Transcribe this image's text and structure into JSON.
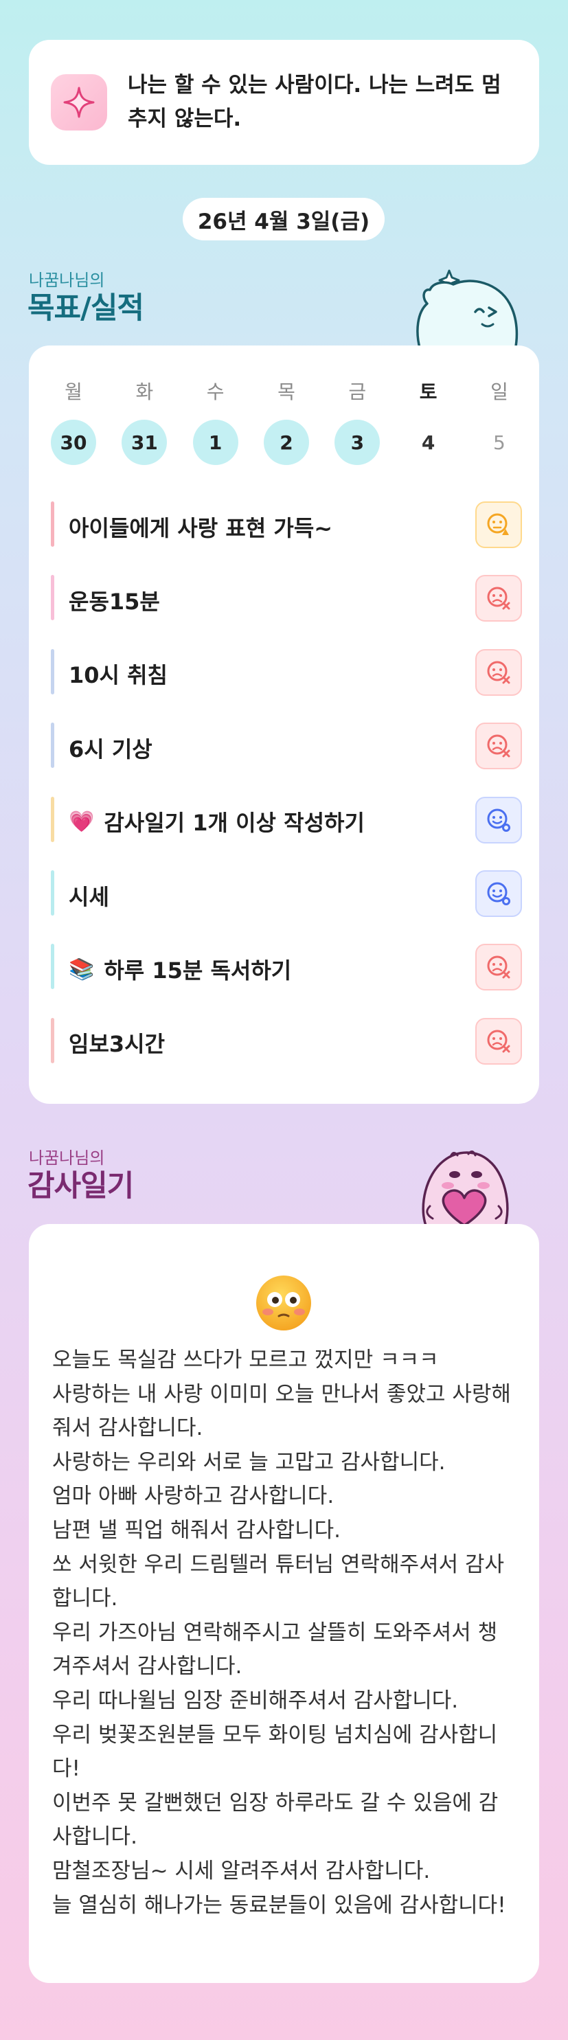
{
  "affirmation": {
    "icon": "sparkle-icon",
    "text": "나는 할 수 있는 사람이다. 나는 느려도 멈추지 않는다."
  },
  "date": "26년 4월 3일(금)",
  "goals_section": {
    "subtitle": "나꿈나님의",
    "title": "목표/실적",
    "accent": "#156d7f"
  },
  "week": [
    {
      "dow": "월",
      "num": "30",
      "state": "done"
    },
    {
      "dow": "화",
      "num": "31",
      "state": "done"
    },
    {
      "dow": "수",
      "num": "1",
      "state": "done"
    },
    {
      "dow": "목",
      "num": "2",
      "state": "done"
    },
    {
      "dow": "금",
      "num": "3",
      "state": "done"
    },
    {
      "dow": "토",
      "num": "4",
      "state": "today"
    },
    {
      "dow": "일",
      "num": "5",
      "state": "future"
    }
  ],
  "goals": [
    {
      "emoji": "",
      "label": "아이들에게 사랑 표현 가득~",
      "bar_color": "#f7b3bd",
      "status": "partial",
      "status_icon": "triangle-face-icon",
      "status_color": "#f5a623"
    },
    {
      "emoji": "",
      "label": "운동15분",
      "bar_color": "#f8bfd8",
      "status": "fail",
      "status_icon": "x-face-icon",
      "status_color": "#f06a6a"
    },
    {
      "emoji": "",
      "label": "10시 취침",
      "bar_color": "#c5d4ef",
      "status": "fail",
      "status_icon": "x-face-icon",
      "status_color": "#f06a6a"
    },
    {
      "emoji": "",
      "label": "6시 기상",
      "bar_color": "#c5d4ef",
      "status": "fail",
      "status_icon": "x-face-icon",
      "status_color": "#f06a6a"
    },
    {
      "emoji": "💗",
      "label": "감사일기 1개 이상 작성하기",
      "bar_color": "#f8dca3",
      "status": "success",
      "status_icon": "o-face-icon",
      "status_color": "#4a6ff0"
    },
    {
      "emoji": "",
      "label": "시세",
      "bar_color": "#b8ecef",
      "status": "success",
      "status_icon": "o-face-icon",
      "status_color": "#4a6ff0"
    },
    {
      "emoji": "📚",
      "label": "하루 15분 독서하기",
      "bar_color": "#b8ecef",
      "status": "fail",
      "status_icon": "x-face-icon",
      "status_color": "#f06a6a"
    },
    {
      "emoji": "",
      "label": "임보3시간",
      "bar_color": "#f7c2c2",
      "status": "fail",
      "status_icon": "x-face-icon",
      "status_color": "#f06a6a"
    }
  ],
  "gratitude_section": {
    "subtitle": "나꿈나님의",
    "title": "감사일기",
    "accent": "#7a2a70"
  },
  "gratitude": {
    "emoji_icon": "flushed-face-icon",
    "lines": [
      "오늘도 목실감 쓰다가 모르고 껐지만 ㅋㅋㅋ",
      "사랑하는 내 사랑 이미미 오늘 만나서 좋았고 사랑해줘서 감사합니다.",
      "사랑하는 우리와 서로 늘 고맙고 감사합니다.",
      "엄마 아빠 사랑하고 감사합니다.",
      "남편 낼 픽업 해줘서 감사합니다.",
      "쏘 서윗한 우리 드림텔러 튜터님 연락해주셔서 감사합니다.",
      "우리 가즈아님 연락해주시고 살뜰히 도와주셔서 챙겨주셔서 감사합니다.",
      "우리 따나윌님 임장 준비해주셔서 감사합니다.",
      "우리 벚꽃조원분들 모두 화이팅 넘치심에 감사합니다!",
      "이번주 못 갈뻔했던 임장 하루라도 갈 수 있음에 감사합니다.",
      "맘철조장님~ 시세 알려주셔서 감사합니다.",
      "늘 열심히 해나가는 동료분들이 있음에 감사합니다!"
    ]
  }
}
